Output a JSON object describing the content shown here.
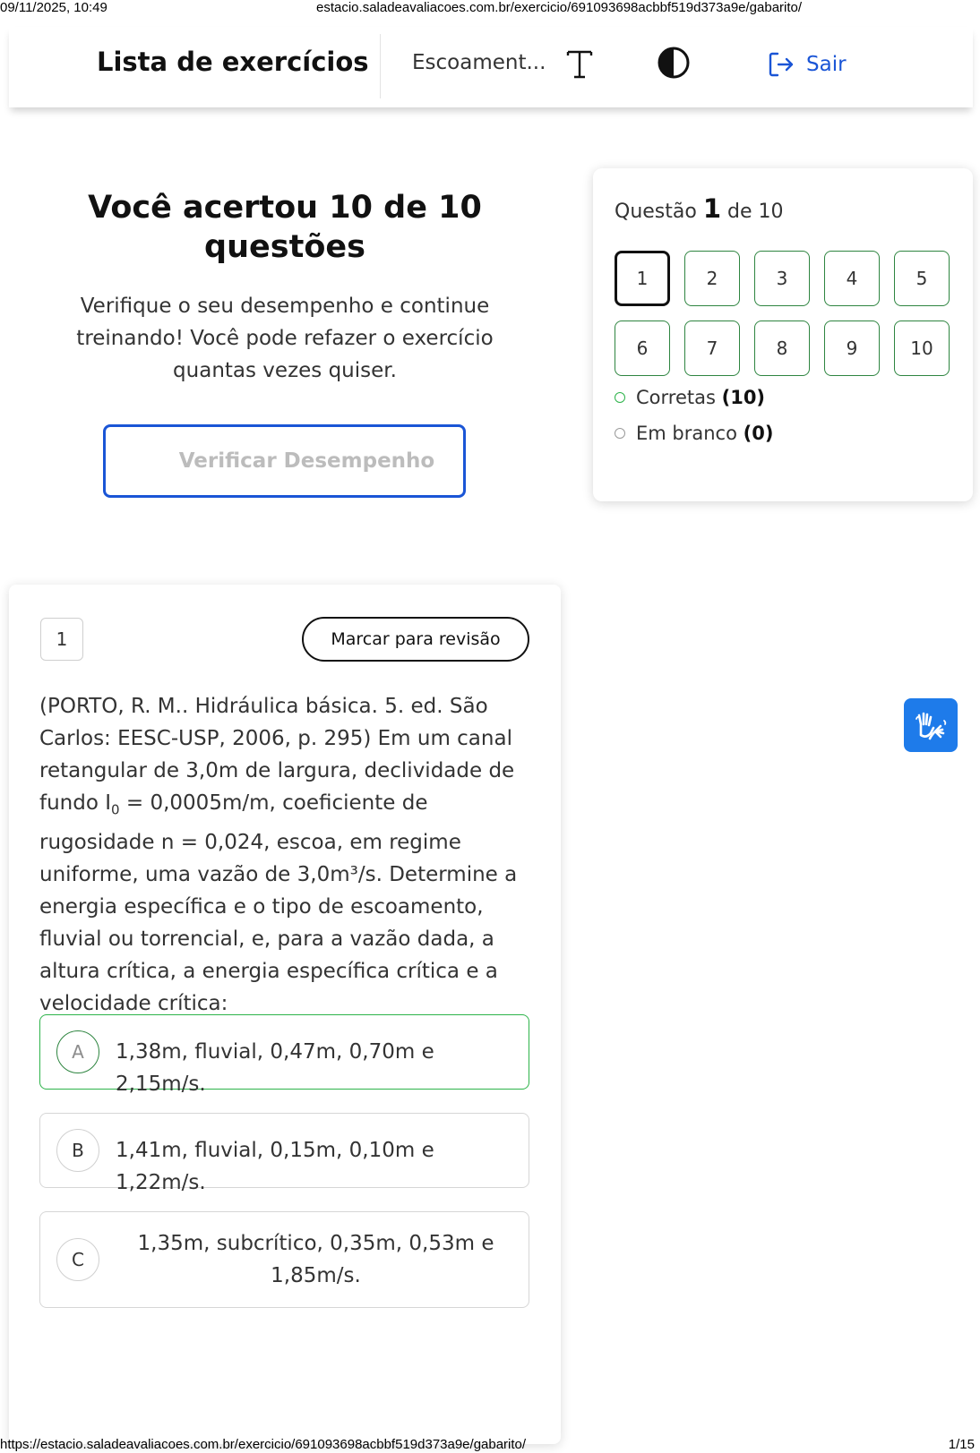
{
  "print_header": {
    "datetime": "09/11/2025, 10:49",
    "url": "estacio.saladeavaliacoes.com.br/exercicio/691093698acbbf519d373a9e/gabarito/"
  },
  "print_footer": {
    "url": "https://estacio.saladeavaliacoes.com.br/exercicio/691093698acbbf519d373a9e/gabarito/",
    "page": "1/15"
  },
  "header": {
    "title": "Lista de exercícios",
    "subtitle": "Escoament...",
    "text_size_icon": "text-size-icon",
    "contrast_icon": "contrast-icon",
    "logout_icon": "logout-icon",
    "logout_label": "Sair",
    "accent_color": "#1a55d6"
  },
  "result": {
    "title": "Você acertou 10 de 10 questões",
    "description": "Verifique o seu desempenho e continue treinando! Você pode refazer o exercício quantas vezes quiser.",
    "verify_button": "Verificar Desempenho"
  },
  "navigator": {
    "label_prefix": "Questão",
    "current": "1",
    "label_suffix": "de 10",
    "questions": [
      "1",
      "2",
      "3",
      "4",
      "5",
      "6",
      "7",
      "8",
      "9",
      "10"
    ],
    "correct_label": "Corretas",
    "correct_count": "(10)",
    "blank_label": "Em branco",
    "blank_count": "(0)",
    "correct_color": "#2db34a"
  },
  "question": {
    "number": "1",
    "mark_review": "Marcar para revisão",
    "text_part1": "(PORTO, R. M.. Hidráulica básica. 5. ed. São Carlos: EESC-USP, 2006, p. 295) Em um canal retangular de 3,0m de largura, declividade de fundo I",
    "text_sub": "0",
    "text_part2": " = 0,0005m/m, coeficiente de rugosidade n = 0,024, escoa, em regime uniforme, uma vazão de 3,0m³/s. Determine a energia específica e o tipo de escoamento, fluvial ou torrencial, e, para a vazão dada, a altura crítica, a energia específica crítica e a velocidade crítica:",
    "options": [
      {
        "letter": "A",
        "text": "1,38m, fluvial, 0,47m, 0,70m e 2,15m/s.",
        "status": "correct"
      },
      {
        "letter": "B",
        "text": "1,41m, fluvial, 0,15m, 0,10m e 1,22m/s."
      },
      {
        "letter": "C",
        "text": "1,35m, subcrítico, 0,35m, 0,53m e 1,85m/s."
      }
    ]
  },
  "accessibility": {
    "libras_icon": "sign-language-hands-icon",
    "color": "#1e7bea"
  }
}
